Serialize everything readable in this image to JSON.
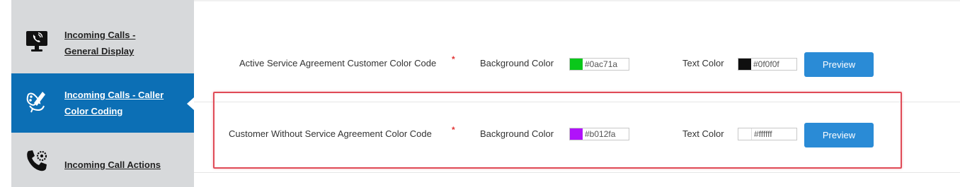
{
  "sidebar": {
    "items": [
      {
        "label": "Incoming Calls - General Display",
        "icon": "monitor-phone-icon",
        "active": false
      },
      {
        "label": "Incoming Calls - Caller Color Coding",
        "icon": "paint-palette-icon",
        "active": true
      },
      {
        "label": "Incoming Call Actions",
        "icon": "phone-gear-icon",
        "active": false
      }
    ]
  },
  "rows": [
    {
      "label": "Active Service Agreement Customer Color Code",
      "required_mark": "*",
      "bg_label": "Background Color",
      "bg_value": "#0ac71a",
      "bg_swatch": "#0ac71a",
      "text_label": "Text Color",
      "text_value": "#0f0f0f",
      "text_swatch": "#0f0f0f",
      "button": "Preview"
    },
    {
      "label": "Customer Without Service Agreement Color Code",
      "required_mark": "*",
      "bg_label": "Background Color",
      "bg_value": "#b012fa",
      "bg_swatch": "#b012fa",
      "text_label": "Text Color",
      "text_value": "#ffffff",
      "text_swatch": "#ffffff",
      "button": "Preview"
    }
  ],
  "colors": {
    "sidebar_bg": "#d7d9db",
    "active_bg": "#0c6fb5",
    "button_bg": "#2a8bd6",
    "highlight": "#e04b57",
    "required": "#e23636"
  }
}
